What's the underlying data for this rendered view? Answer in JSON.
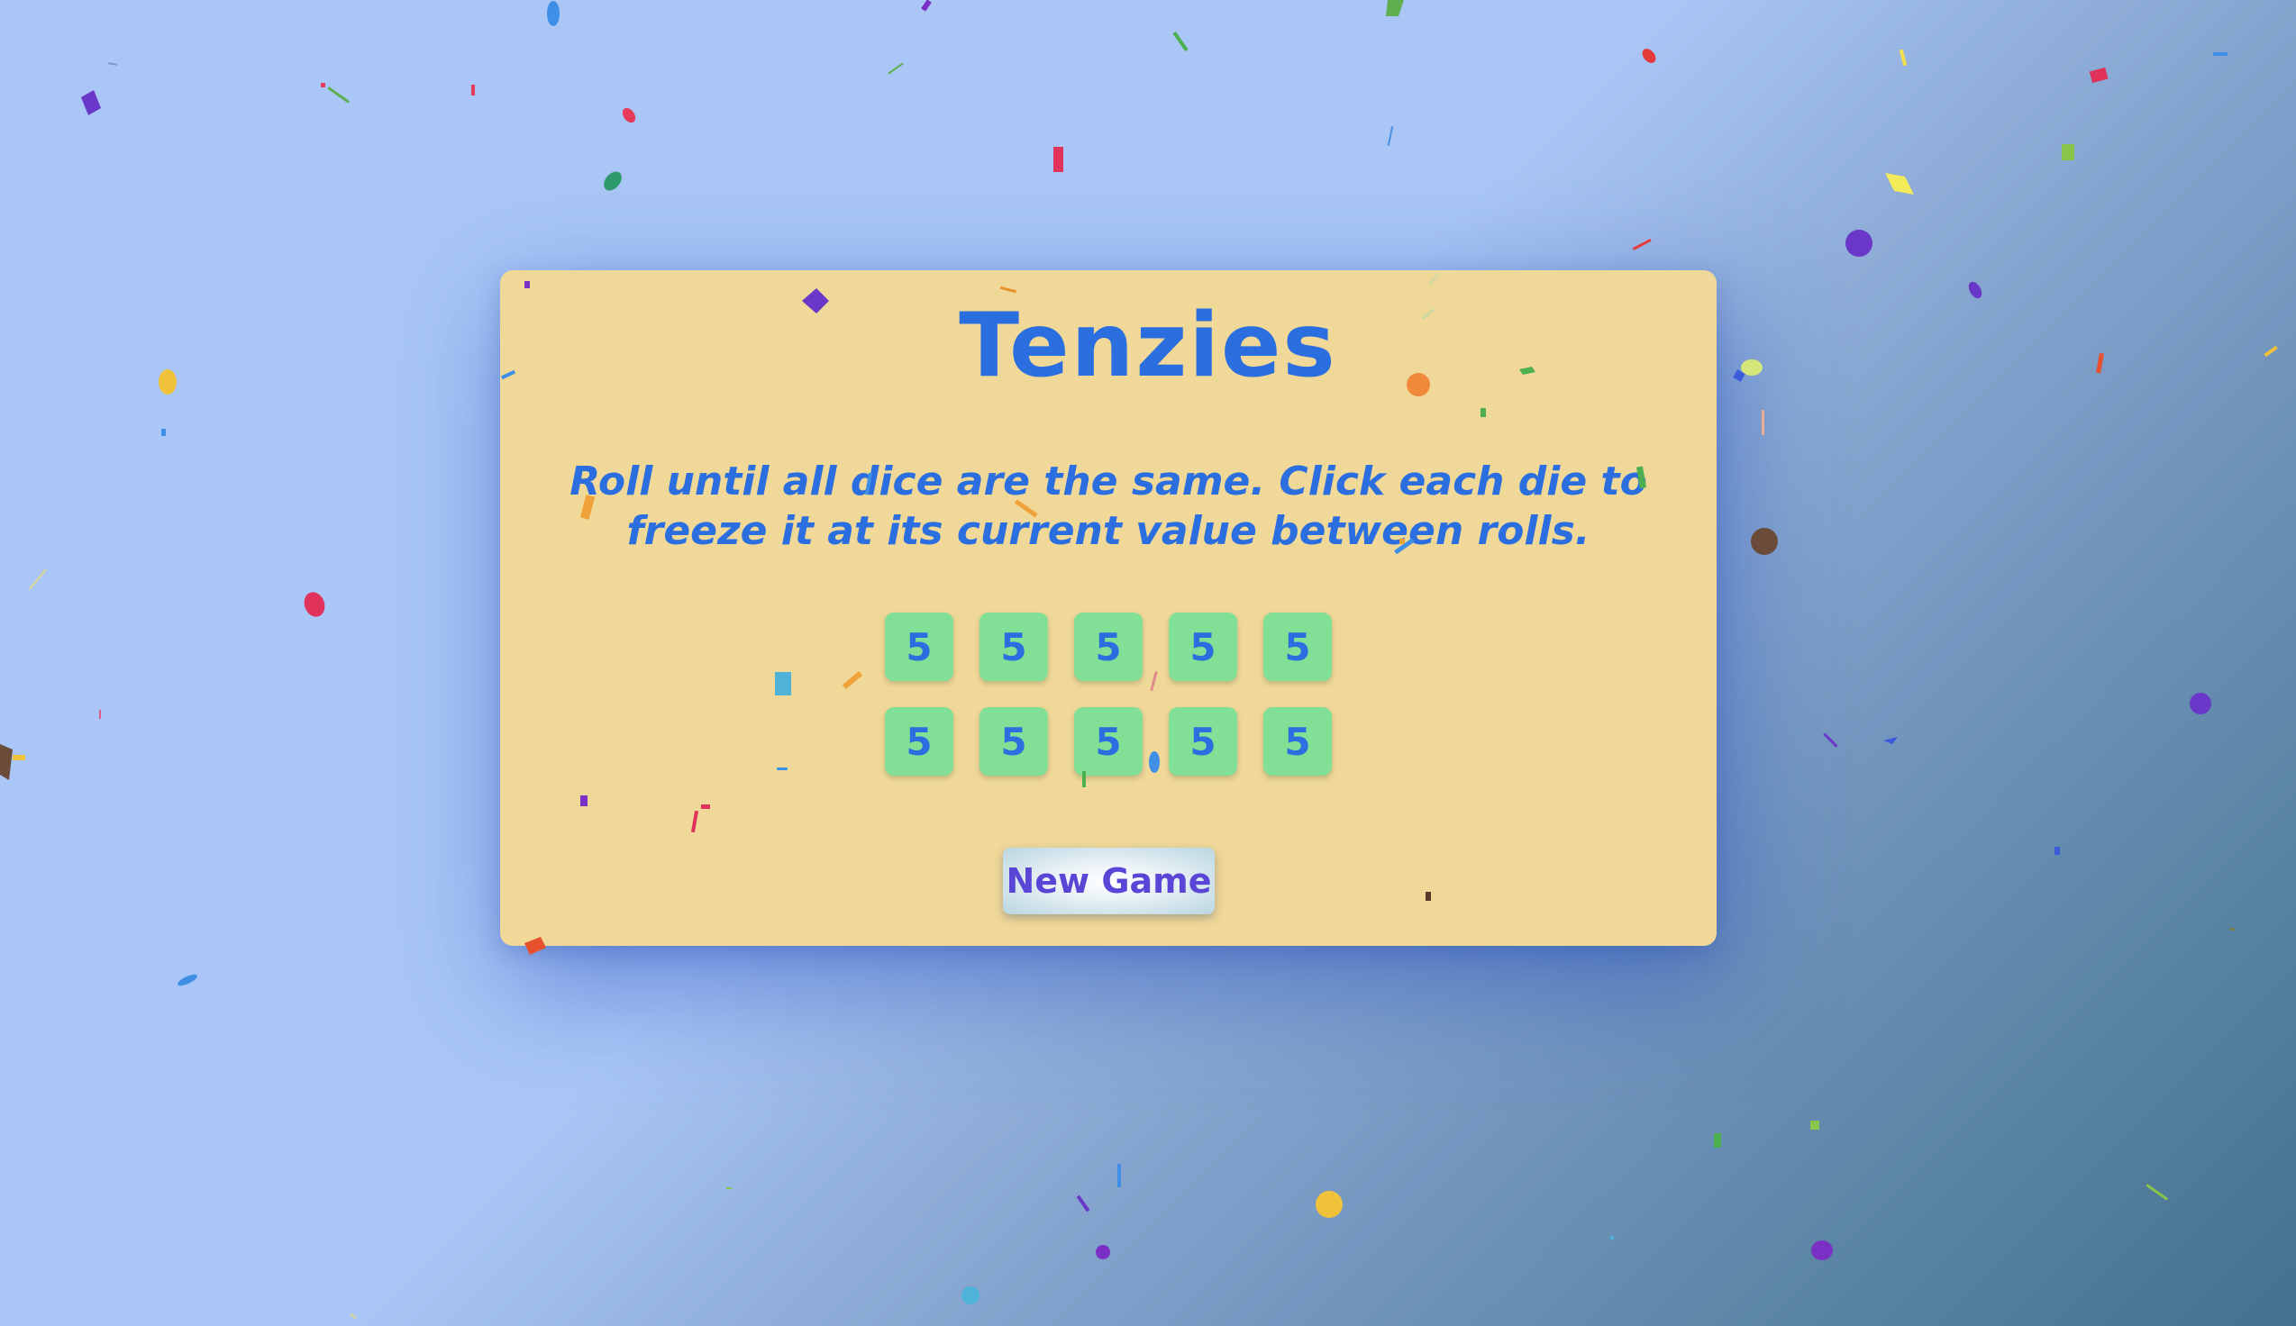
{
  "app": {
    "title": "Tenzies",
    "instructions": "Roll until all dice are the same. Click each die to freeze it at its current value between rolls."
  },
  "dice": [
    "5",
    "5",
    "5",
    "5",
    "5",
    "5",
    "5",
    "5",
    "5",
    "5"
  ],
  "buttons": {
    "new_game_label": "New Game"
  },
  "colors": {
    "accent_text": "#2b6ee0",
    "card_background": "#f0d898",
    "die_held": "#82df96",
    "button_text": "#5946d6"
  },
  "icons": [
    "confetti"
  ]
}
